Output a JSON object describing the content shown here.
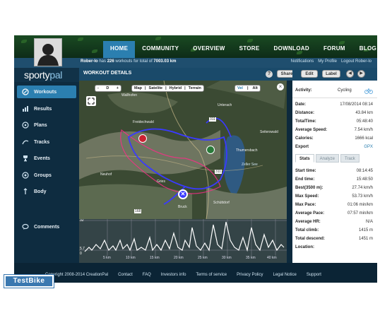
{
  "nav": {
    "items": [
      "HOME",
      "COMMUNITY",
      "OVERVIEW",
      "STORE",
      "DOWNLOAD",
      "FORUM",
      "BLOG"
    ],
    "active": "HOME"
  },
  "info": {
    "user": "Rober-lo",
    "text_mid": "has",
    "workouts": "226",
    "text_mid2": "workouts for total of",
    "distance": "7003.03 km",
    "links": [
      "Notifications",
      "My Profile",
      "Logout Rober-lo"
    ]
  },
  "logo": {
    "part1": "sporty",
    "part2": "pal"
  },
  "sidebar": {
    "items": [
      {
        "label": "Workouts",
        "icon": "workouts-icon",
        "active": true
      },
      {
        "label": "Results",
        "icon": "results-icon"
      },
      {
        "label": "Plans",
        "icon": "plans-icon"
      },
      {
        "label": "Tracks",
        "icon": "tracks-icon"
      },
      {
        "label": "Events",
        "icon": "events-icon"
      },
      {
        "label": "Groups",
        "icon": "groups-icon"
      },
      {
        "label": "Body",
        "icon": "body-icon"
      },
      {
        "label": "Comments",
        "icon": "comments-icon"
      }
    ]
  },
  "workout": {
    "title": "WORKOUT DETAILS",
    "help": "?",
    "buttons": [
      "Share",
      "Edit",
      "Label"
    ]
  },
  "map": {
    "zoom_controls": [
      "-",
      "D",
      "+"
    ],
    "types": [
      "Map",
      "Satelite",
      "Hybrid",
      "Terrain"
    ],
    "modes": [
      "Vel",
      "Alt"
    ],
    "labels": [
      "Wallhofen",
      "Unterach",
      "Freidechwald",
      "Thumersbach",
      "Seiterswald",
      "Zeller See",
      "Bruck",
      "Schüttdorf",
      "Gries",
      "Neuhof"
    ],
    "route_markers": [
      "311",
      "168",
      "311"
    ]
  },
  "elevation": {
    "y_labels": [
      "32",
      "5.7",
      "0"
    ],
    "x_labels": [
      "5 km",
      "10 km",
      "15 km",
      "20 km",
      "25 km",
      "30 km",
      "35 km",
      "40 km"
    ]
  },
  "details": {
    "activity_label": "Activity:",
    "activity": "Cycling",
    "rows": [
      {
        "k": "Date:",
        "v": "17/08/2014 08:14"
      },
      {
        "k": "Distance:",
        "v": "43.84 km"
      },
      {
        "k": "TotalTime:",
        "v": "05:48:40"
      },
      {
        "k": "Average Speed:",
        "v": "7.54 km/h"
      },
      {
        "k": "Calories:",
        "v": "1666 kcal"
      },
      {
        "k": "Export",
        "v": "GPX"
      }
    ],
    "tabs": [
      "Stats",
      "Analyze",
      "Track"
    ],
    "stats": [
      {
        "k": "Start time:",
        "v": "08:14:45"
      },
      {
        "k": "End time:",
        "v": "15:48:50"
      },
      {
        "k": "Best(3500 m):",
        "v": "27.74 km/h"
      },
      {
        "k": "Max Speed:",
        "v": "53.73 km/h"
      },
      {
        "k": "Max Pace:",
        "v": "01:06 min/km"
      },
      {
        "k": "Average Pace:",
        "v": "07:57 min/km"
      },
      {
        "k": "Average HR:",
        "v": "N/A"
      },
      {
        "k": "Total climb:",
        "v": "1415 m"
      },
      {
        "k": "Total descend:",
        "v": "1451 m"
      },
      {
        "k": "Location:",
        "v": ""
      }
    ]
  },
  "footer": {
    "copyright": "Copyright 2008-2014 CreationPal",
    "links": [
      "Contact",
      "FAQ",
      "Investors info",
      "Terms of service",
      "Privacy Policy",
      "Legal Notice",
      "Support"
    ]
  },
  "watermark": "TestBike",
  "colors": {
    "accent": "#2b7fb0",
    "route": "#3a3aff",
    "header": "#0e2c18"
  }
}
